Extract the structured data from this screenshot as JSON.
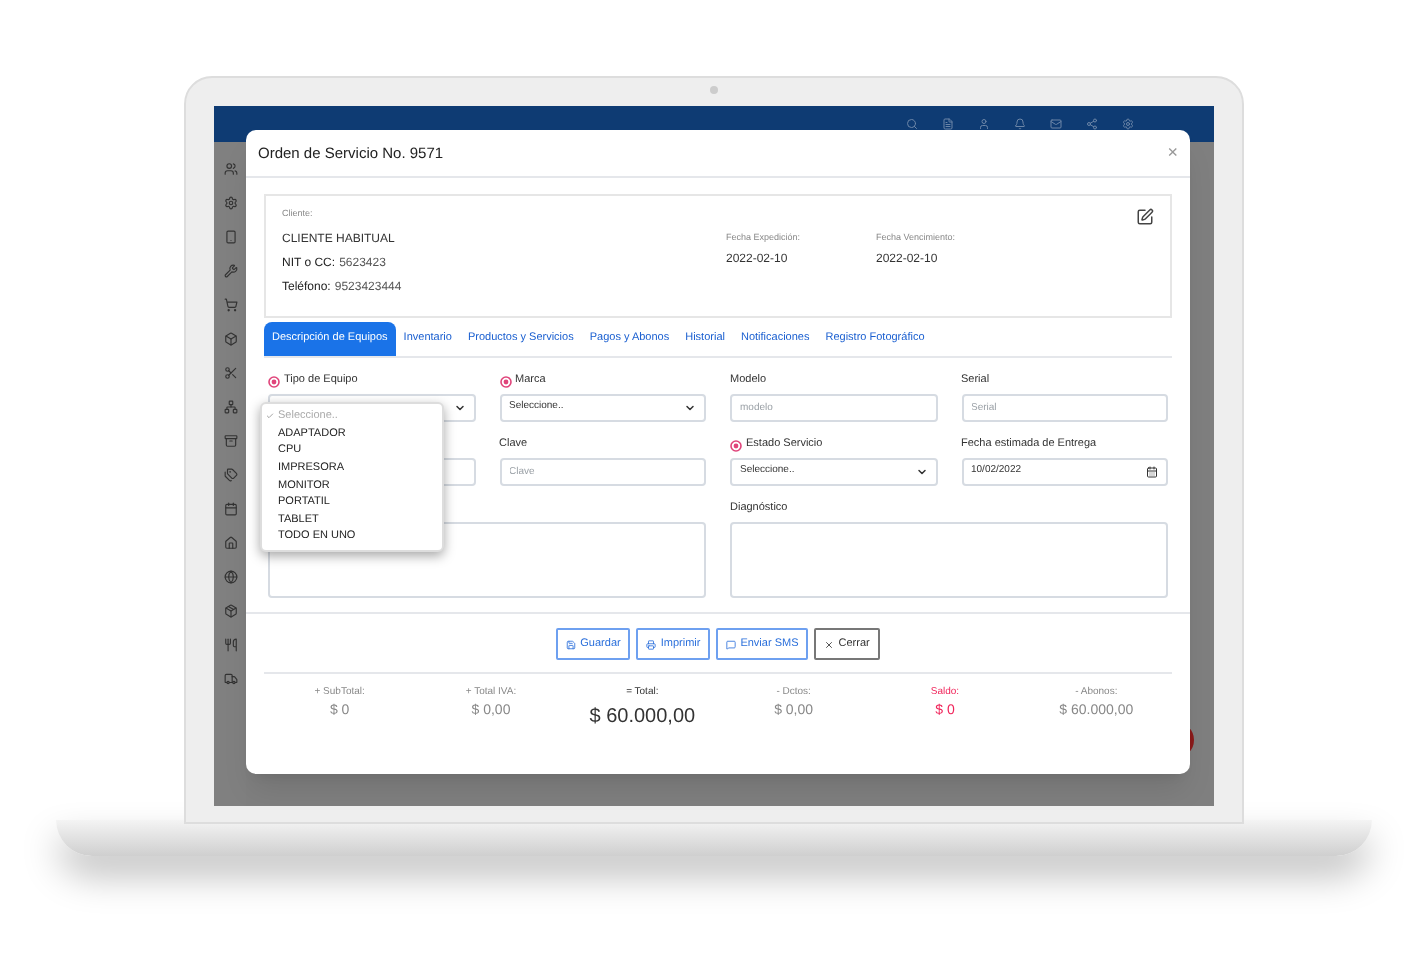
{
  "modal": {
    "title": "Orden de Servicio No. 9571",
    "close": "×",
    "client": {
      "label": "Cliente:",
      "name": "CLIENTE HABITUAL",
      "id_label": "NIT o CC:",
      "id": "5623423",
      "phone_label": "Teléfono:",
      "phone": "9523423444"
    },
    "dates": [
      {
        "label": "Fecha Expedición:",
        "value": "2022-02-10"
      },
      {
        "label": "Fecha Vencimiento:",
        "value": "2022-02-10"
      }
    ],
    "tabs": [
      {
        "label": "Descripción de Equipos",
        "selected": true
      },
      {
        "label": "Inventario",
        "selected": false
      },
      {
        "label": "Productos y Servicios",
        "selected": false
      },
      {
        "label": "Pagos y Abonos",
        "selected": false
      },
      {
        "label": "Historial",
        "selected": false
      },
      {
        "label": "Notificaciones",
        "selected": false
      },
      {
        "label": "Registro Fotográfico",
        "selected": false
      }
    ],
    "fields": [
      {
        "kind": "select",
        "label": "Tipo de Equipo",
        "required": true
      },
      {
        "kind": "select",
        "label": "Marca",
        "required": true,
        "value": "Seleccione.."
      },
      {
        "kind": "input",
        "label": "Modelo",
        "required": false,
        "placeholder": "modelo"
      },
      {
        "kind": "input",
        "label": "Serial",
        "required": false,
        "placeholder": "Serial"
      },
      {
        "kind": "input"
      },
      {
        "kind": "input",
        "label": "Clave",
        "required": false,
        "placeholder": "Clave"
      },
      {
        "kind": "select",
        "label": "Estado Servicio",
        "required": true,
        "value": "Seleccione.."
      },
      {
        "kind": "date",
        "label": "Fecha estimada de Entrega",
        "required": false,
        "value": "10/02/2022"
      },
      {
        "kind": "textarea"
      },
      {
        "kind": "textarea",
        "label": "Diagnóstico",
        "required": false
      }
    ],
    "dropdown": {
      "options": [
        {
          "label": "Seleccione..",
          "selected": true
        },
        {
          "label": "ADAPTADOR",
          "selected": false
        },
        {
          "label": "CPU",
          "selected": false
        },
        {
          "label": "IMPRESORA",
          "selected": false
        },
        {
          "label": "MONITOR",
          "selected": false
        },
        {
          "label": "PORTATIL",
          "selected": false
        },
        {
          "label": "TABLET",
          "selected": false
        },
        {
          "label": "TODO EN UNO",
          "selected": false
        }
      ]
    },
    "buttons": [
      {
        "kind": "save",
        "label": "Guardar"
      },
      {
        "kind": "print",
        "label": "Imprimir"
      },
      {
        "kind": "sms",
        "label": "Enviar SMS"
      },
      {
        "kind": "close",
        "label": "Cerrar"
      }
    ],
    "totals": [
      {
        "label": "+ SubTotal:",
        "value": "$ 0",
        "kind": "normal"
      },
      {
        "label": "+ Total IVA:",
        "value": "$ 0,00",
        "kind": "normal"
      },
      {
        "label": "= Total:",
        "value": "$ 60.000,00",
        "kind": "total"
      },
      {
        "label": "- Dctos:",
        "value": "$ 0,00",
        "kind": "normal"
      },
      {
        "label": "Saldo:",
        "value": "$ 0",
        "kind": "balance"
      },
      {
        "label": "- Abonos:",
        "value": "$ 60.000,00",
        "kind": "normal"
      }
    ]
  }
}
